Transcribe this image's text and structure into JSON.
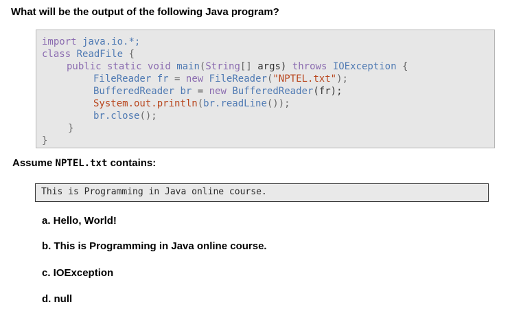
{
  "question": "What will be the output of the following Java program?",
  "code": {
    "line1": {
      "kw": "import",
      "rest": "java.io.*;"
    },
    "line2": {
      "kw": "class",
      "name": "ReadFile",
      "brace": "{"
    },
    "line3": {
      "kw1": "public",
      "kw2": "static",
      "kw3": "void",
      "main": "main",
      "type": "String",
      "args": "args)",
      "throws": "throws",
      "exc": "IOException",
      "brace": "{"
    },
    "line4": {
      "type": "FileReader",
      "var": "fr",
      "op": "=",
      "new": "new",
      "ctor": "FileReader",
      "str": "\"NPTEL.txt\"",
      "end": ");"
    },
    "line5": {
      "type": "BufferedReader",
      "var": "br",
      "op": "=",
      "new": "new",
      "ctor": "BufferedReader",
      "arg": "(fr);"
    },
    "line6": {
      "sys": "System.out.println",
      "br": "br.readLine",
      "end": "());"
    },
    "line7": {
      "br": "br.close",
      "end": "();"
    },
    "line8": {
      "brace": "}"
    },
    "line9": {
      "brace": "}"
    }
  },
  "assume": {
    "prefix": "Assume",
    "file": "NPTEL.txt",
    "suffix": "contains:"
  },
  "file_content": "This is Programming in Java online course.",
  "options": [
    "a.  Hello, World!",
    "b.  This is Programming in Java online course.",
    "c.  IOException",
    "d.  null"
  ]
}
